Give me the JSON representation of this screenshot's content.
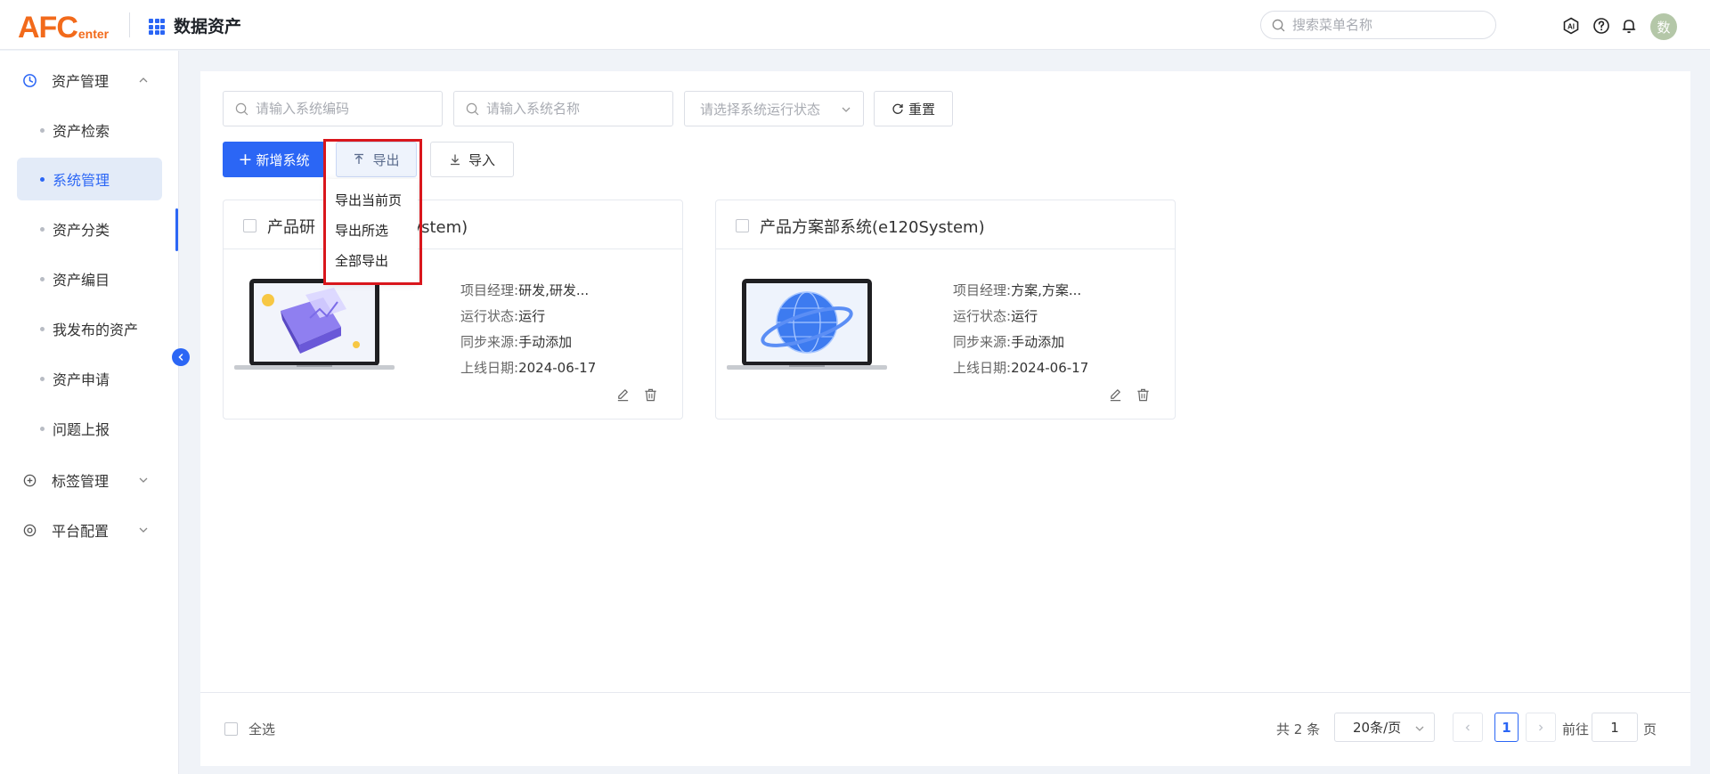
{
  "header": {
    "logo_main": "AFC",
    "logo_sub": "enter",
    "app_title": "数据资产",
    "search_placeholder": "搜索菜单名称",
    "avatar_text": "数"
  },
  "sidebar": {
    "groups": [
      {
        "label": "资产管理",
        "icon": "clock-icon",
        "expanded": true
      },
      {
        "label": "标签管理",
        "icon": "plus-circle-icon",
        "expanded": false
      },
      {
        "label": "平台配置",
        "icon": "settings-icon",
        "expanded": false
      }
    ],
    "items": [
      {
        "label": "资产检索"
      },
      {
        "label": "系统管理",
        "selected": true
      },
      {
        "label": "资产分类"
      },
      {
        "label": "资产编目"
      },
      {
        "label": "我发布的资产"
      },
      {
        "label": "资产申请"
      },
      {
        "label": "问题上报"
      }
    ]
  },
  "filters": {
    "code_placeholder": "请输入系统编码",
    "name_placeholder": "请输入系统名称",
    "status_placeholder": "请选择系统运行状态",
    "reset_label": "重置"
  },
  "toolbar": {
    "add_label": "新增系统",
    "export_label": "导出",
    "import_label": "导入"
  },
  "export_menu": {
    "items": [
      "导出当前页",
      "导出所选",
      "全部导出"
    ]
  },
  "cards": [
    {
      "title": "产品研",
      "title_tail": "System)",
      "manager_key": "项目经理:",
      "manager_val": "研发,研发...",
      "status_key": "运行状态:",
      "status_val": "运行",
      "source_key": "同步来源:",
      "source_val": "手动添加",
      "date_key": "上线日期:",
      "date_val": "2024-06-17"
    },
    {
      "title": "产品方案部系统(e120System)",
      "manager_key": "项目经理:",
      "manager_val": "方案,方案...",
      "status_key": "运行状态:",
      "status_val": "运行",
      "source_key": "同步来源:",
      "source_val": "手动添加",
      "date_key": "上线日期:",
      "date_val": "2024-06-17"
    }
  ],
  "footer": {
    "select_all": "全选",
    "total": "共 2 条",
    "page_size": "20条/页",
    "current_page": "1",
    "goto_prefix": "前往",
    "goto_value": "1",
    "goto_suffix": "页"
  },
  "colors": {
    "primary": "#2b66f5",
    "brand_orange": "#f26a1b",
    "highlight_red": "#d9161c"
  }
}
